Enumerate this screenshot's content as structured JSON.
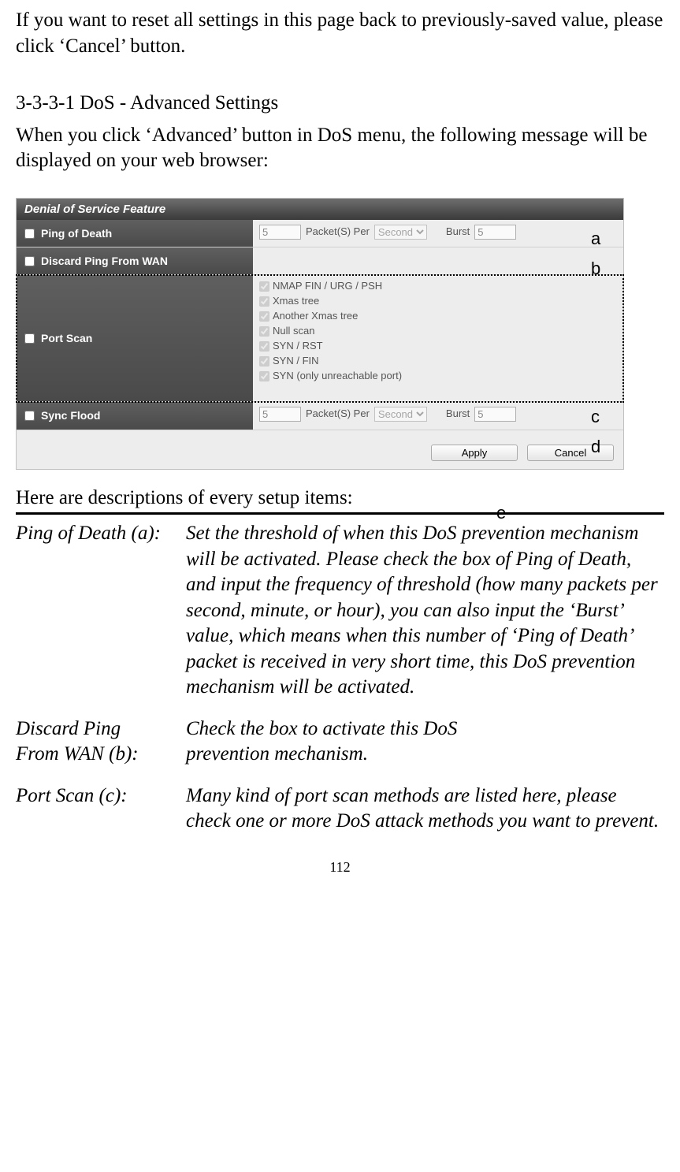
{
  "intro": {
    "para1": "If you want to reset all settings in this page back to previously-saved value, please click ‘Cancel’ button."
  },
  "section": {
    "number": "3-3-3-1 DoS - Advanced Settings",
    "para": "When you click ‘Advanced’ button in DoS menu, the following message will be displayed on your web browser:"
  },
  "dos": {
    "title": "Denial of Service Feature",
    "ping_of_death": {
      "label": "Ping of Death",
      "packets_value": "5",
      "packets_label": "Packet(S) Per",
      "unit_selected": "Second",
      "burst_label": "Burst",
      "burst_value": "5"
    },
    "discard_ping": {
      "label": "Discard Ping From WAN"
    },
    "port_scan": {
      "label": "Port Scan",
      "methods": [
        "NMAP FIN / URG / PSH",
        "Xmas tree",
        "Another Xmas tree",
        "Null scan",
        "SYN / RST",
        "SYN / FIN",
        "SYN (only unreachable port)"
      ]
    },
    "sync_flood": {
      "label": "Sync Flood",
      "packets_value": "5",
      "packets_label": "Packet(S) Per",
      "unit_selected": "Second",
      "burst_label": "Burst",
      "burst_value": "5"
    },
    "buttons": {
      "apply": "Apply",
      "cancel": "Cancel"
    }
  },
  "callouts": {
    "a": "a",
    "b": "b",
    "c": "c",
    "d": "d",
    "e": "e"
  },
  "desc": {
    "intro": "Here are descriptions of every setup items:",
    "items": [
      {
        "left": "Ping of Death (a):",
        "right": "Set the threshold of when this DoS prevention mechanism will be activated. Please check the box of Ping of Death, and input the frequency of threshold (how many packets per second, minute, or hour), you can also input the ‘Burst’ value, which means when this number of ‘Ping of Death’ packet is received in very short time, this DoS prevention mechanism will be activated."
      },
      {
        "left_line1": "Discard Ping",
        "left_line2": "From WAN (b):",
        "right_line1": "Check the box to activate this DoS",
        "right_line2": "prevention mechanism."
      },
      {
        "left": "Port Scan (c):",
        "right": "Many kind of port scan methods are listed here, please check one or more DoS attack methods you want to prevent."
      }
    ]
  },
  "page_number": "112"
}
